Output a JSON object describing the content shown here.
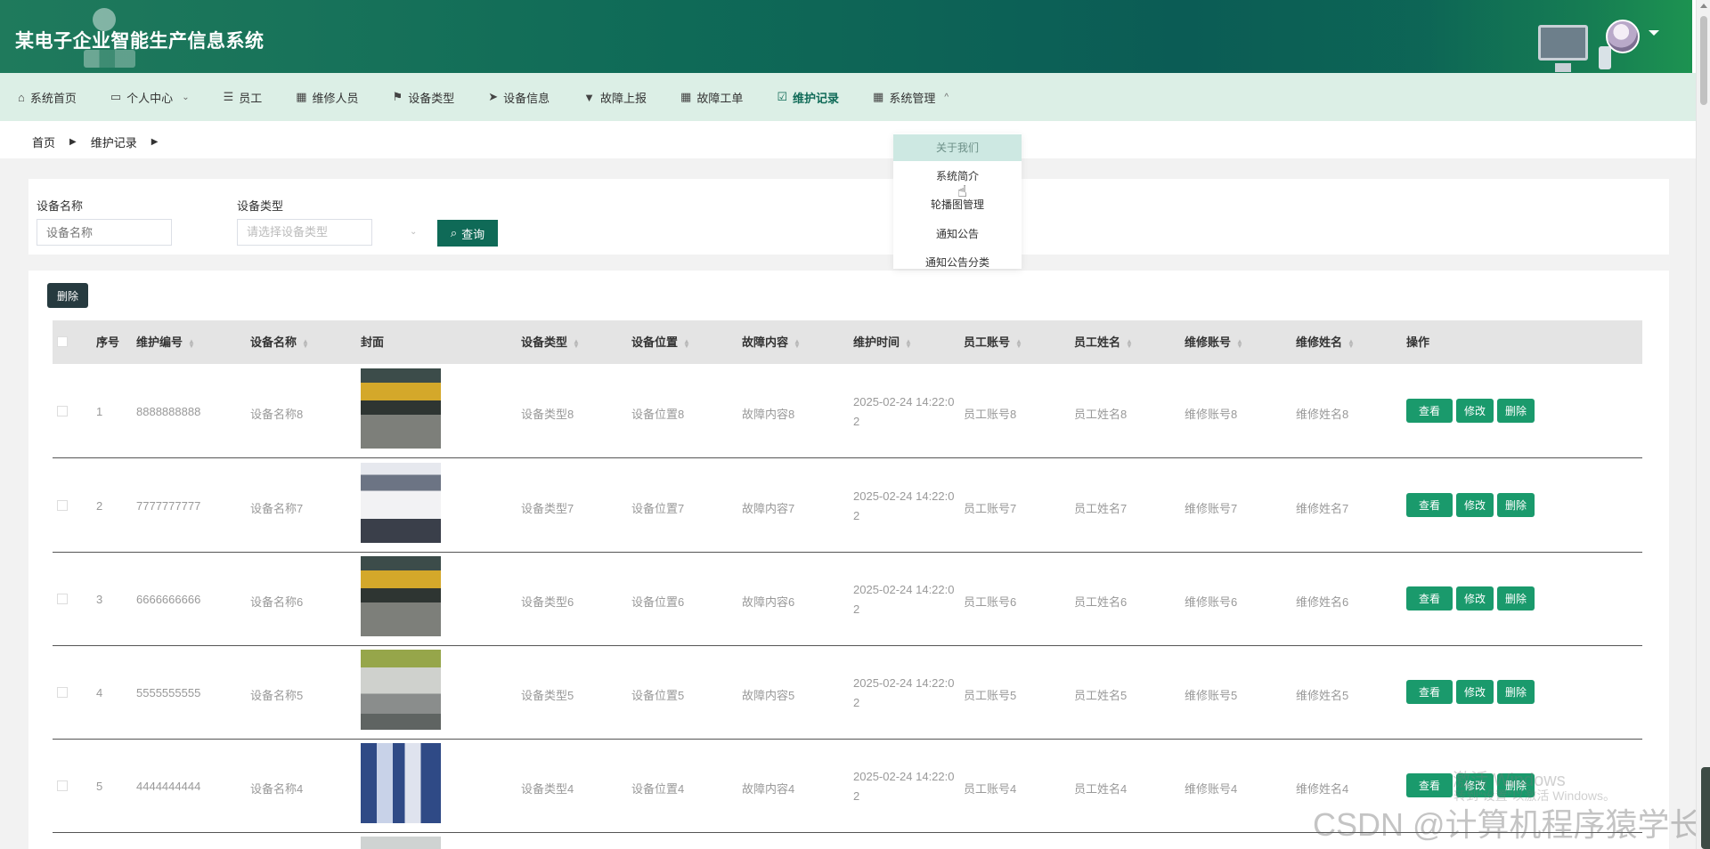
{
  "header": {
    "app_title": "某电子企业智能生产信息系统",
    "avatar_icon": "user-avatar",
    "caret_icon": "caret-down-icon",
    "bg_color": "#0f6a57"
  },
  "nav": {
    "items": [
      {
        "label": "系统首页",
        "icon": "home-icon"
      },
      {
        "label": "个人中心",
        "icon": "id-card-icon",
        "caret": "⌄"
      },
      {
        "label": "员工",
        "icon": "list-icon"
      },
      {
        "label": "维修人员",
        "icon": "grid-icon"
      },
      {
        "label": "设备类型",
        "icon": "flag-icon"
      },
      {
        "label": "设备信息",
        "icon": "send-icon"
      },
      {
        "label": "故障上报",
        "icon": "stamp-icon"
      },
      {
        "label": "故障工单",
        "icon": "grid-icon"
      },
      {
        "label": "维护记录",
        "icon": "clipboard-check-icon",
        "active": true
      },
      {
        "label": "系统管理",
        "icon": "grid-icon",
        "caret": "^"
      }
    ]
  },
  "breadcrumb": {
    "home": "首页",
    "current": "维护记录"
  },
  "dropdown": {
    "items": [
      "关于我们",
      "系统简介",
      "轮播图管理",
      "通知公告",
      "通知公告分类"
    ]
  },
  "search": {
    "device_name_label": "设备名称",
    "device_name_placeholder": "设备名称",
    "device_type_label": "设备类型",
    "device_type_placeholder": "请选择设备类型",
    "query_button": "查询"
  },
  "toolbar": {
    "bulk_delete": "删除"
  },
  "table": {
    "headers": {
      "index": "序号",
      "maint_no": "维护编号",
      "device_name": "设备名称",
      "cover": "封面",
      "device_type": "设备类型",
      "device_location": "设备位置",
      "fault": "故障内容",
      "maint_time": "维护时间",
      "emp_account": "员工账号",
      "emp_name": "员工姓名",
      "rep_account": "维修账号",
      "rep_name": "维修姓名",
      "actions": "操作"
    },
    "rows": [
      {
        "index": "1",
        "maint_no": "8888888888",
        "device_name": "设备名称8",
        "device_type": "设备类型8",
        "device_location": "设备位置8",
        "fault": "故障内容8",
        "time_line1": "2025-02-24 14:22:0",
        "time_line2": "2",
        "emp_account": "员工账号8",
        "emp_name": "员工姓名8",
        "rep_account": "维修账号8",
        "rep_name": "维修姓名8"
      },
      {
        "index": "2",
        "maint_no": "7777777777",
        "device_name": "设备名称7",
        "device_type": "设备类型7",
        "device_location": "设备位置7",
        "fault": "故障内容7",
        "time_line1": "2025-02-24 14:22:0",
        "time_line2": "2",
        "emp_account": "员工账号7",
        "emp_name": "员工姓名7",
        "rep_account": "维修账号7",
        "rep_name": "维修姓名7"
      },
      {
        "index": "3",
        "maint_no": "6666666666",
        "device_name": "设备名称6",
        "device_type": "设备类型6",
        "device_location": "设备位置6",
        "fault": "故障内容6",
        "time_line1": "2025-02-24 14:22:0",
        "time_line2": "2",
        "emp_account": "员工账号6",
        "emp_name": "员工姓名6",
        "rep_account": "维修账号6",
        "rep_name": "维修姓名6"
      },
      {
        "index": "4",
        "maint_no": "5555555555",
        "device_name": "设备名称5",
        "device_type": "设备类型5",
        "device_location": "设备位置5",
        "fault": "故障内容5",
        "time_line1": "2025-02-24 14:22:0",
        "time_line2": "2",
        "emp_account": "员工账号5",
        "emp_name": "员工姓名5",
        "rep_account": "维修账号5",
        "rep_name": "维修姓名5"
      },
      {
        "index": "5",
        "maint_no": "4444444444",
        "device_name": "设备名称4",
        "device_type": "设备类型4",
        "device_location": "设备位置4",
        "fault": "故障内容4",
        "time_line1": "2025-02-24 14:22:0",
        "time_line2": "2",
        "emp_account": "员工账号4",
        "emp_name": "员工姓名4",
        "rep_account": "维修账号4",
        "rep_name": "维修姓名4"
      }
    ],
    "actions": {
      "view": "查看",
      "edit": "修改",
      "delete": "删除"
    }
  },
  "watermarks": {
    "activate": "激活 Windows",
    "activate_sub": "转到“设置”以激活 Windows。",
    "csdn": "CSDN @计算机程序猿学长"
  },
  "colors": {
    "primary": "#0f6a57",
    "action_button": "#1a9a6c",
    "nav_bg": "#dcefe6"
  }
}
